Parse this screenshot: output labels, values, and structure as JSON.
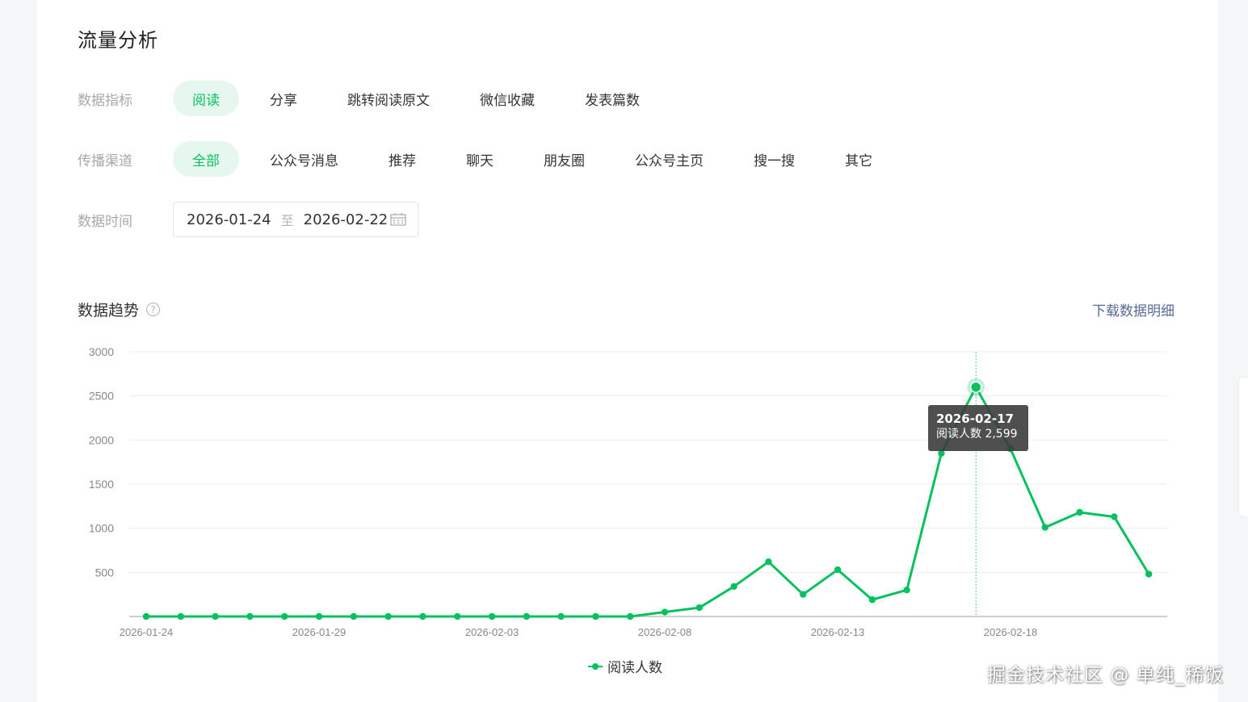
{
  "page_title": "流量分析",
  "filters": {
    "metric": {
      "label": "数据指标",
      "options": [
        "阅读",
        "分享",
        "跳转阅读原文",
        "微信收藏",
        "发表篇数"
      ],
      "selected": "阅读"
    },
    "channel": {
      "label": "传播渠道",
      "options": [
        "全部",
        "公众号消息",
        "推荐",
        "聊天",
        "朋友圈",
        "公众号主页",
        "搜一搜",
        "其它"
      ],
      "selected": "全部"
    },
    "date": {
      "label": "数据时间",
      "start": "2026-01-24",
      "separator": "至",
      "end": "2026-02-22",
      "icon": "calendar-icon"
    }
  },
  "trend": {
    "title": "数据趋势",
    "help_icon": "question-circle-icon",
    "download_label": "下载数据明细"
  },
  "tooltip": {
    "date": "2026-02-17",
    "label": "阅读人数 2,599"
  },
  "watermark": "掘金技术社区 @ 单纯_稀饭",
  "colors": {
    "accent": "#07c160",
    "accent_bg": "#e6f7ef",
    "link": "#576b95"
  },
  "chart_data": {
    "type": "line",
    "x": [
      "2026-01-24",
      "2026-01-25",
      "2026-01-26",
      "2026-01-27",
      "2026-01-28",
      "2026-01-29",
      "2026-01-30",
      "2026-01-31",
      "2026-02-01",
      "2026-02-02",
      "2026-02-03",
      "2026-02-04",
      "2026-02-05",
      "2026-02-06",
      "2026-02-07",
      "2026-02-08",
      "2026-02-09",
      "2026-02-10",
      "2026-02-11",
      "2026-02-12",
      "2026-02-13",
      "2026-02-14",
      "2026-02-15",
      "2026-02-16",
      "2026-02-17",
      "2026-02-18",
      "2026-02-19",
      "2026-02-20",
      "2026-02-21",
      "2026-02-22"
    ],
    "x_tick_labels": [
      "2026-01-24",
      "2026-01-29",
      "2026-02-03",
      "2026-02-08",
      "2026-02-13",
      "2026-02-18"
    ],
    "y_tick_labels": [
      "500",
      "1000",
      "1500",
      "2000",
      "2500",
      "3000"
    ],
    "ylim": [
      0,
      3000
    ],
    "grid": true,
    "legend_position": "bottom-center",
    "series": [
      {
        "name": "阅读人数",
        "color": "#07c160",
        "values": [
          0,
          0,
          0,
          0,
          0,
          0,
          0,
          0,
          0,
          0,
          0,
          0,
          0,
          0,
          0,
          50,
          100,
          340,
          620,
          250,
          530,
          190,
          300,
          1850,
          2599,
          1900,
          1010,
          1180,
          1130,
          480
        ]
      }
    ],
    "highlight_index": 24
  }
}
